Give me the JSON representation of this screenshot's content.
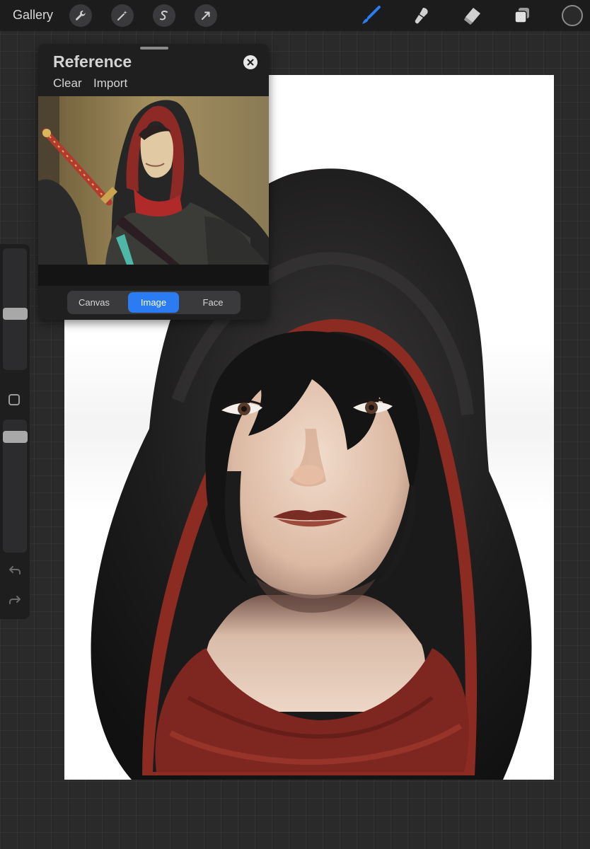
{
  "topbar": {
    "gallery_label": "Gallery",
    "left_icons": [
      "wrench-icon",
      "magic-wand-icon",
      "selection-icon",
      "transform-arrow-icon"
    ],
    "right_icons": [
      "brush-icon",
      "smudge-icon",
      "eraser-icon",
      "layers-icon"
    ],
    "active_tool": "brush",
    "accent_color": "#2b7bf2",
    "current_color": "#2a2a2a"
  },
  "sidebar": {
    "brush_size_level": 0.45,
    "opacity_level": 0.95
  },
  "reference": {
    "title": "Reference",
    "clear_label": "Clear",
    "import_label": "Import",
    "tabs": [
      {
        "label": "Canvas",
        "active": false
      },
      {
        "label": "Image",
        "active": true
      },
      {
        "label": "Face",
        "active": false
      }
    ]
  },
  "colors": {
    "hood_black": "#1b1a1a",
    "hood_lining_red": "#8c2b22",
    "skin": "#e8cdb8",
    "panel_bg": "#1f1f20"
  }
}
